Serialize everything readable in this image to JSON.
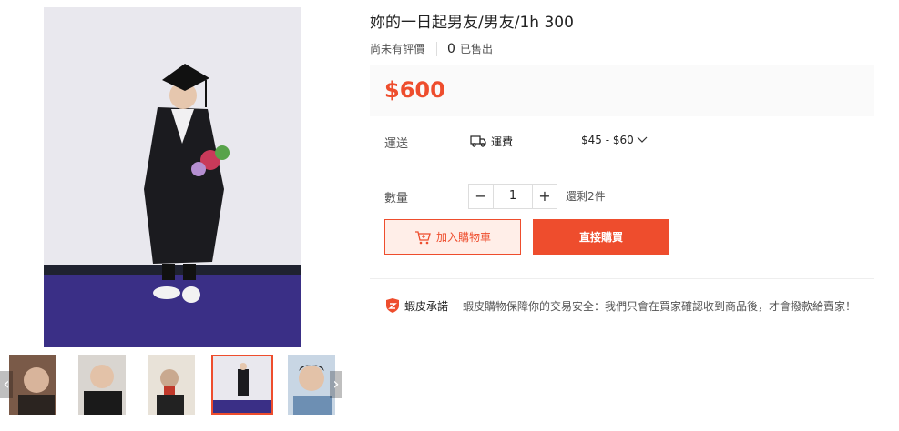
{
  "product": {
    "title": "妳的一日起男友/男友/1h 300",
    "rating_text": "尚未有評價",
    "sold_count": "0",
    "sold_label": "已售出",
    "price": "$600"
  },
  "shipping": {
    "label": "運送",
    "fee_label": "運費",
    "fee_range": "$45 - $60"
  },
  "quantity": {
    "label": "數量",
    "decrement": "−",
    "value": "1",
    "increment": "+",
    "stock_text": "還剩2件"
  },
  "actions": {
    "add_to_cart": "加入購物車",
    "buy_now": "直接購買"
  },
  "guarantee": {
    "title": "蝦皮承諾",
    "text": "蝦皮購物保障你的交易安全：我們只會在買家確認收到商品後，才會撥款給賣家！"
  },
  "gallery": {
    "prev_arrow": "‹",
    "next_arrow": "›",
    "active_index": 3
  },
  "colors": {
    "accent": "#ee4d2d",
    "accent_light": "#ffeee8",
    "price_bg": "#fafafa"
  },
  "icons": {
    "shipping": "truck-icon",
    "cart": "cart-icon",
    "guarantee": "shield-icon",
    "dropdown": "chevron-down-icon"
  }
}
